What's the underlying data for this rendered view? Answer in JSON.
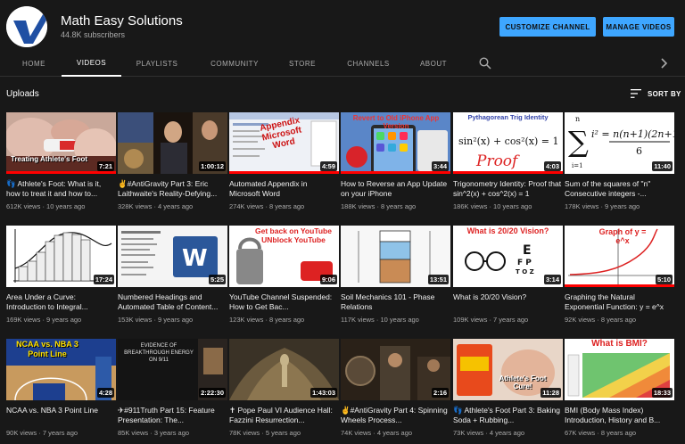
{
  "channel": {
    "name": "Math Easy Solutions",
    "subscribers": "44.8K subscribers",
    "customize_label": "CUSTOMIZE CHANNEL",
    "manage_label": "MANAGE VIDEOS"
  },
  "tabs": [
    "HOME",
    "VIDEOS",
    "PLAYLISTS",
    "COMMUNITY",
    "STORE",
    "CHANNELS",
    "ABOUT"
  ],
  "active_tab": "VIDEOS",
  "uploads": {
    "title": "Uploads",
    "sort_label": "SORT BY"
  },
  "videos": [
    {
      "title": "👣 Athlete's Foot: What is it, how to treat it and how to...",
      "views": "612K views",
      "age": "10 years ago",
      "duration": "7:21",
      "thumb_text": "Treating Athlete's Foot",
      "progress": 1.0
    },
    {
      "title": "✌#AntiGravity Part 3: Eric Laithwaite's Reality-Defying...",
      "views": "328K views",
      "age": "4 years ago",
      "duration": "1:00:12",
      "thumb_text": "",
      "progress": 0
    },
    {
      "title": "Automated Appendix in Microsoft Word",
      "views": "274K views",
      "age": "8 years ago",
      "duration": "4:59",
      "thumb_text": "Appendix Microsoft Word",
      "progress": 1.0
    },
    {
      "title": "How to Reverse an App Update on your iPhone",
      "views": "188K views",
      "age": "8 years ago",
      "duration": "3:44",
      "thumb_text": "Revert to Old iPhone App Version",
      "progress": 1.0
    },
    {
      "title": "Trigonometry Identity: Proof that sin^2(x) + cos^2(x) = 1",
      "views": "186K views",
      "age": "10 years ago",
      "duration": "4:03",
      "thumb_text": "Pythagorean Trig Identity",
      "progress": 1.0
    },
    {
      "title": "Sum of the squares of \"n\" Consecutive integers -...",
      "views": "178K views",
      "age": "9 years ago",
      "duration": "11:40",
      "thumb_text": "",
      "progress": 0
    },
    {
      "title": "Area Under a Curve: Introduction to Integral...",
      "views": "169K views",
      "age": "9 years ago",
      "duration": "17:24",
      "thumb_text": "",
      "progress": 0
    },
    {
      "title": "Numbered Headings and Automated Table of Content...",
      "views": "153K views",
      "age": "9 years ago",
      "duration": "5:25",
      "thumb_text": "",
      "progress": 0
    },
    {
      "title": "YouTube Channel Suspended: How to Get Bac...",
      "views": "123K views",
      "age": "8 years ago",
      "duration": "9:06",
      "thumb_text": "Get back on YouTube UNblock YouTube",
      "progress": 0
    },
    {
      "title": "Soil Mechanics 101 - Phase Relations",
      "views": "117K views",
      "age": "10 years ago",
      "duration": "13:51",
      "thumb_text": "",
      "progress": 0
    },
    {
      "title": "What is 20/20 Vision?",
      "views": "109K views",
      "age": "7 years ago",
      "duration": "3:14",
      "thumb_text": "What is 20/20 Vision?",
      "progress": 0
    },
    {
      "title": "Graphing the Natural Exponential Function: y = e^x",
      "views": "92K views",
      "age": "8 years ago",
      "duration": "5:10",
      "thumb_text": "Graph of y = e^x",
      "progress": 1.0
    },
    {
      "title": "NCAA vs. NBA 3 Point Line",
      "views": "90K views",
      "age": "7 years ago",
      "duration": "4:28",
      "thumb_text": "NCAA vs. NBA 3 Point Line",
      "progress": 0
    },
    {
      "title": "✈#911Truth Part 15: Feature Presentation: The...",
      "views": "85K views",
      "age": "3 years ago",
      "duration": "2:22:30",
      "thumb_text": "EVIDENCE OF BREAKTHROUGH ENERGY ON 9/11",
      "progress": 0
    },
    {
      "title": "✝ Pope Paul VI Audience Hall: Fazzini Resurrection...",
      "views": "78K views",
      "age": "5 years ago",
      "duration": "1:43:03",
      "thumb_text": "",
      "progress": 0
    },
    {
      "title": "✌#AntiGravity Part 4: Spinning Wheels Process...",
      "views": "74K views",
      "age": "4 years ago",
      "duration": "2:16",
      "thumb_text": "",
      "progress": 0
    },
    {
      "title": "👣 Athlete's Foot Part 3: Baking Soda + Rubbing...",
      "views": "73K views",
      "age": "4 years ago",
      "duration": "11:28",
      "thumb_text": "Athlete's Foot Cure!",
      "progress": 0
    },
    {
      "title": "BMI (Body Mass Index) Introduction, History and B...",
      "views": "67K views",
      "age": "8 years ago",
      "duration": "18:33",
      "thumb_text": "What is BMI?",
      "progress": 0
    }
  ],
  "icons": {
    "search": "search-icon",
    "next": "chevron-right-icon",
    "sort": "sort-icon",
    "avatar": "checkmark-logo-icon"
  },
  "colors": {
    "accent": "#3ea6ff",
    "background": "#181818",
    "progress": "#ff0000",
    "brand_blue": "#1f4fa3"
  }
}
